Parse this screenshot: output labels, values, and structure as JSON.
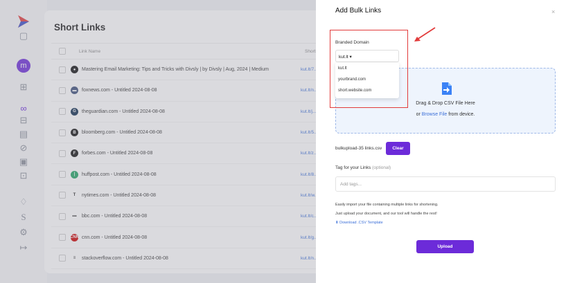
{
  "main": {
    "title": "Short Links",
    "columns": {
      "name": "Link Name",
      "short": "Short Li"
    },
    "rows": [
      {
        "fav": "●",
        "favColor": "#111111",
        "name": "Mastering Email Marketing: Tips and Tricks with Divsly | by Divsly | Aug, 2024 | Medium",
        "short": "kut.lt/7..."
      },
      {
        "fav": "▬",
        "favColor": "#3c4f7a",
        "name": "foxnews.com - Untitled 2024-08-08",
        "short": "kut.lt/n..."
      },
      {
        "fav": "G",
        "favColor": "#0d2b4e",
        "name": "theguardian.com - Untitled 2024-08-08",
        "short": "kut.lt/j..."
      },
      {
        "fav": "B",
        "favColor": "#111111",
        "name": "bloomberg.com - Untitled 2024-08-08",
        "short": "kut.lt/5..."
      },
      {
        "fav": "F",
        "favColor": "#111111",
        "name": "forbes.com - Untitled 2024-08-08",
        "short": "kut.lt/z..."
      },
      {
        "fav": "|",
        "favColor": "#1fa463",
        "name": "huffpost.com - Untitled 2024-08-08",
        "short": "kut.lt/8..."
      },
      {
        "fav": "T",
        "favColor": "#ffffff",
        "name": "nytimes.com - Untitled 2024-08-08",
        "short": "kut.lt/w..."
      },
      {
        "fav": "•••",
        "favColor": "#ffffff",
        "name": "bbc.com - Untitled 2024-08-08",
        "short": "kut.lt/c..."
      },
      {
        "fav": "CNN",
        "favColor": "#cc0000",
        "name": "cnn.com - Untitled 2024-08-08",
        "short": "kut.lt/g..."
      },
      {
        "fav": "≡",
        "favColor": "#ffffff",
        "name": "stackoverflow.com - Untitled 2024-08-08",
        "short": "kut.lt/n..."
      }
    ]
  },
  "sidebar": {
    "avatar": "m"
  },
  "panel": {
    "title": "Add Bulk Links",
    "close": "×",
    "domain_label": "Branded Domain",
    "domain_selected": "kut.lt ▾",
    "domain_options": [
      "kut.lt",
      "yourbrand.com",
      "short.website.com"
    ],
    "drop_text": "Drag & Drop CSV File Here",
    "drop_or": "or ",
    "drop_browse": "Browse File",
    "drop_from": " from device.",
    "filename": "bulkupload-35 links.csv",
    "clear": "Clear",
    "tag_label": "Tag for your Links",
    "tag_optional": "(optional)",
    "tag_placeholder": "Add tags...",
    "info1": "Easily import your file containing multiple links for shortening.",
    "info2": "Just upload your document, and our tool will handle the rest!",
    "template": "Download .CSV Template",
    "upload": "Upload"
  },
  "colors": {
    "accent": "#6c2bd9",
    "link": "#3b6fd8",
    "highlight": "#e23b3b"
  }
}
